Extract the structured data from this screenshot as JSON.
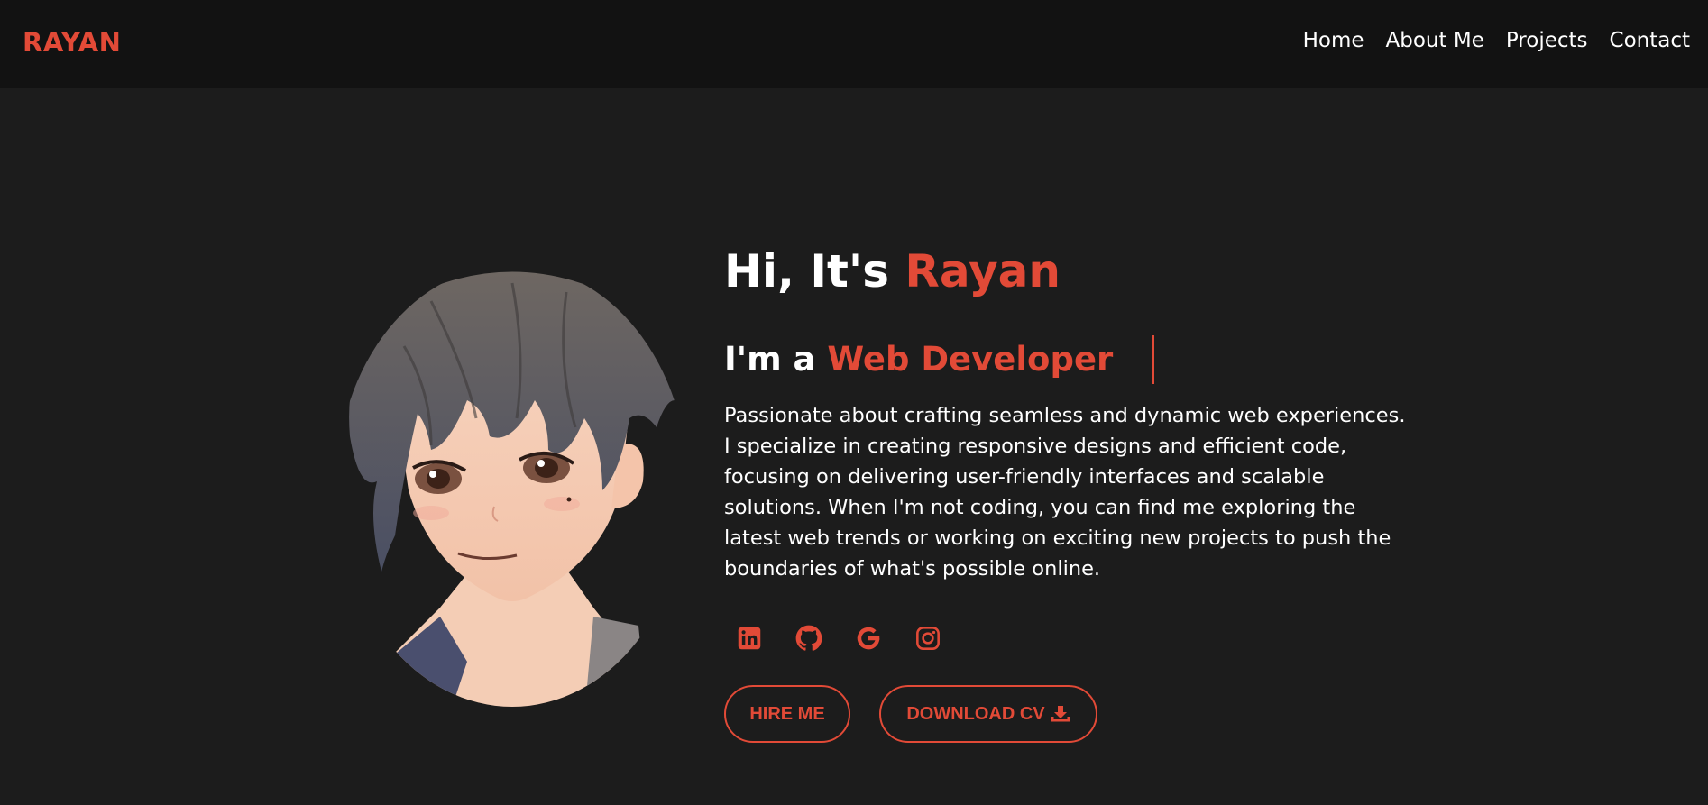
{
  "nav": {
    "logo": "RAYAN",
    "links": [
      "Home",
      "About Me",
      "Projects",
      "Contact"
    ]
  },
  "hero": {
    "greeting_prefix": "Hi, It's ",
    "greeting_name": "Rayan",
    "role_prefix": "I'm a ",
    "role_title": "Web Developer",
    "bio": "Passionate about crafting seamless and dynamic web experiences. I specialize in creating responsive designs and efficient code, focusing on delivering user-friendly interfaces and scalable solutions. When I'm not coding, you can find me exploring the latest web trends or working on exciting new projects to push the boundaries of what's possible online."
  },
  "socials": [
    {
      "icon": "linkedin-icon"
    },
    {
      "icon": "github-icon"
    },
    {
      "icon": "google-icon"
    },
    {
      "icon": "instagram-icon"
    }
  ],
  "buttons": {
    "hire": "HIRE ME",
    "cv": "DOWNLOAD CV"
  },
  "colors": {
    "accent": "#e24a37",
    "background": "#1c1c1c",
    "navbar": "#121212",
    "text": "#ffffff"
  }
}
